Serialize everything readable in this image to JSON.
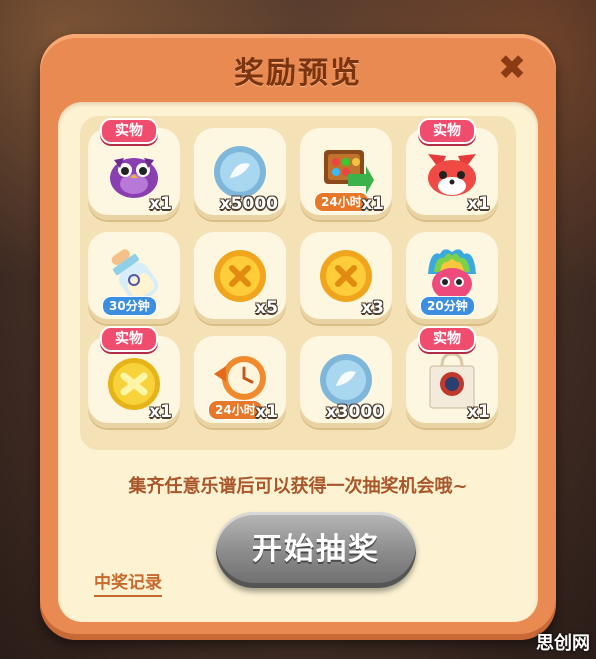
{
  "dialog": {
    "title": "奖励预览",
    "close_label": "✖",
    "hint": "集齐任意乐谱后可以获得一次抽奖机会哦~",
    "draw_button": "开始抽奖",
    "record_link": "中奖记录"
  },
  "rewards": [
    {
      "icon": "purple-owl-plush-icon",
      "tag": "实物",
      "qty": "x1",
      "timer": ""
    },
    {
      "icon": "blue-coin-icon",
      "tag": "",
      "qty": "x5000",
      "timer": ""
    },
    {
      "icon": "gift-chest-icon",
      "tag": "",
      "qty": "x1",
      "timer": "24小时"
    },
    {
      "icon": "red-fox-plush-icon",
      "tag": "实物",
      "qty": "x1",
      "timer": ""
    },
    {
      "icon": "baby-bottle-icon",
      "tag": "",
      "qty": "",
      "timer": "30分钟"
    },
    {
      "icon": "gold-coin-icon",
      "tag": "",
      "qty": "x5",
      "timer": ""
    },
    {
      "icon": "gold-coin-icon",
      "tag": "",
      "qty": "x3",
      "timer": ""
    },
    {
      "icon": "rainbow-owl-icon",
      "tag": "",
      "qty": "",
      "timer": "20分钟"
    },
    {
      "icon": "gold-badge-icon",
      "tag": "实物",
      "qty": "x1",
      "timer": ""
    },
    {
      "icon": "clock-refresh-icon",
      "tag": "",
      "qty": "x1",
      "timer": "24小时"
    },
    {
      "icon": "blue-coin-icon",
      "tag": "",
      "qty": "x3000",
      "timer": ""
    },
    {
      "icon": "tote-bag-icon",
      "tag": "实物",
      "qty": "x1",
      "timer": ""
    }
  ],
  "watermark": "思创网"
}
